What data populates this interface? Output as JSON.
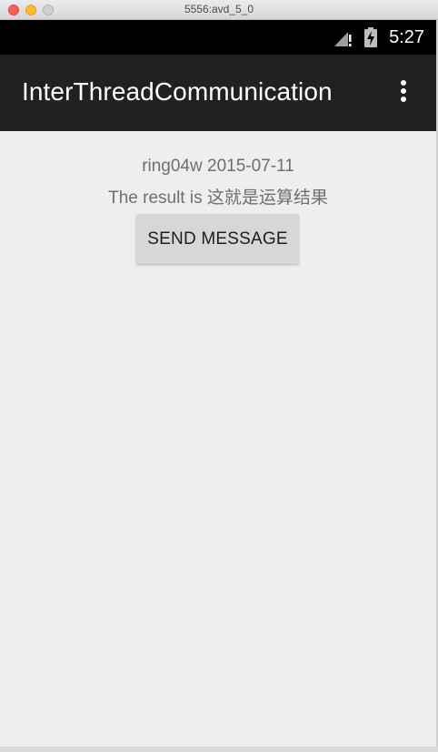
{
  "window": {
    "title": "5556:avd_5_0"
  },
  "status_bar": {
    "time": "5:27",
    "icons": [
      "cell-signal-no-data-icon",
      "battery-charging-icon"
    ]
  },
  "action_bar": {
    "title": "InterThreadCommunication",
    "menu_icon": "overflow-menu-icon"
  },
  "content": {
    "line1": "ring04w 2015-07-11",
    "line2": "The result is 这就是运算结果",
    "button_label": "SEND MESSAGE"
  },
  "colors": {
    "action_bar": "#212121",
    "status_bar": "#000000",
    "background": "#eeeeee",
    "button": "#d6d7d7",
    "text": "#6f6f6f"
  }
}
